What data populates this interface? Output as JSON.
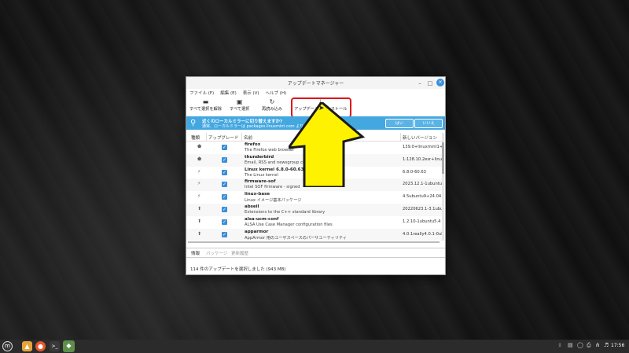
{
  "window": {
    "title": "アップデートマネージャー",
    "min": "–",
    "max": "□",
    "close": "×"
  },
  "menubar": [
    "ファイル (F)",
    "編集 (E)",
    "表示 (V)",
    "ヘルプ (H)"
  ],
  "toolbar": {
    "deselect_all": "すべて選択を解除",
    "select_all": "すべて選択",
    "refresh": "再読み込み",
    "install_updates": "アップデートをインストール"
  },
  "banner": {
    "title": "近くのローカルミラーに切り替えますか?",
    "text": "通常、ローカルミラーは packages.linuxmint.com よりも高速です",
    "yes": "はい",
    "no": "いいえ"
  },
  "table": {
    "headers": [
      "種類",
      "アップグレード",
      "名前",
      "新しいバージョン"
    ],
    "rows": [
      {
        "type_icon": "shield-icon",
        "name": "firefox",
        "desc": "The Firefox web browser",
        "version": "139.0+linuxmint1+v"
      },
      {
        "type_icon": "shield-icon",
        "name": "thunderbird",
        "desc": "Email, RSS and newsgroup client with ... ter",
        "version": "1:128.10.2esr+linux"
      },
      {
        "type_icon": "kernel-icon",
        "name": "Linux kernel 6.8.0-60.63",
        "desc": "The Linux kernel",
        "version": "6.8.0-60.63"
      },
      {
        "type_icon": "kernel-icon",
        "name": "firmware-sof",
        "desc": "Intel SOF firmware - signed",
        "version": "2023.12.1-1ubuntu1"
      },
      {
        "type_icon": "kernel-icon",
        "name": "linux-base",
        "desc": "Linux イメージ基本パッケージ",
        "version": "4.5ubuntu9+24.04.1"
      },
      {
        "type_icon": "update-icon",
        "name": "abseil",
        "desc": "Extensions to the C++ standard library",
        "version": "20220623.1-3.1ubu"
      },
      {
        "type_icon": "update-icon",
        "name": "alsa-ucm-conf",
        "desc": "ALSA Use Case Manager configuration files",
        "version": "1.2.10-1ubuntu5.4"
      },
      {
        "type_icon": "update-icon",
        "name": "apparmor",
        "desc": "AppArmor 用のユーザスペースのパーサユーティリティ",
        "version": "4.0.1really4.0.1-0ubu"
      }
    ]
  },
  "tabs": [
    "情報",
    "パッケージ",
    "更新履歴"
  ],
  "status": "114 件のアップデートを選択しました (943 MB)",
  "taskbar": {
    "clock": "17:56"
  },
  "colors": {
    "banner": "#43a7e0",
    "highlight": "#e0141a",
    "arrow": "#fff200",
    "checkbox": "#3c8fd8"
  }
}
